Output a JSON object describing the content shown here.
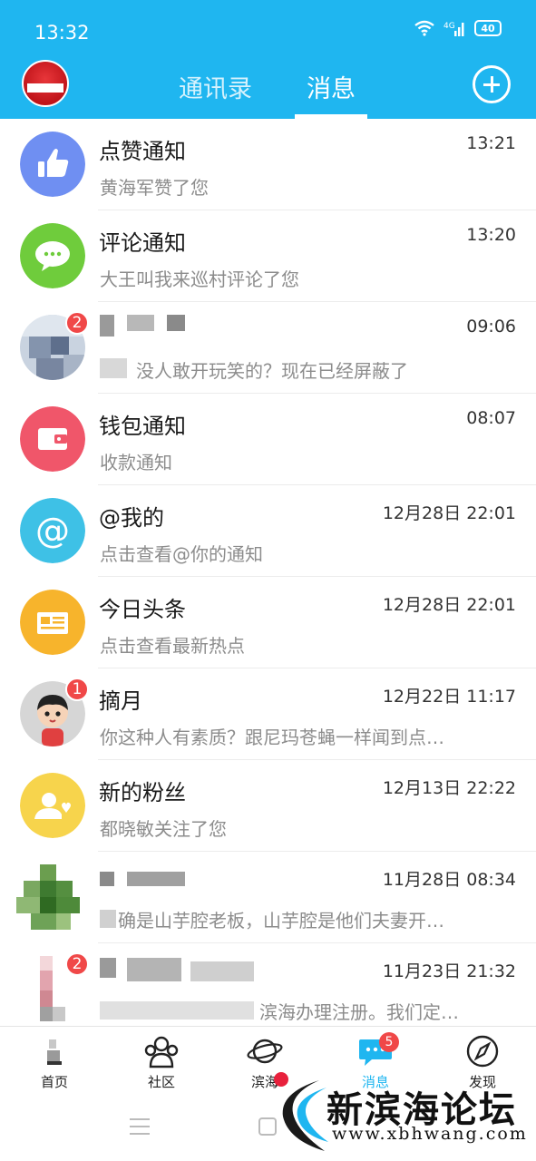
{
  "status": {
    "time": "13:32",
    "battery": "40"
  },
  "header": {
    "tabs": [
      {
        "label": "通讯录"
      },
      {
        "label": "消息"
      }
    ],
    "active_tab": "消息"
  },
  "messages": [
    {
      "title": "点赞通知",
      "time": "13:21",
      "preview": "黄海军赞了您",
      "icon": "thumbs-up-icon",
      "color": "#6f8ff2"
    },
    {
      "title": "评论通知",
      "time": "13:20",
      "preview": "大王叫我来巡村评论了您",
      "icon": "chat-bubble-icon",
      "color": "#6fcc3c"
    },
    {
      "title": "",
      "time": "09:06",
      "preview": "没人敢开玩笑的？现在已经屏蔽了",
      "badge": "2",
      "icon": "user-avatar",
      "color": "#9aaac0"
    },
    {
      "title": "钱包通知",
      "time": "08:07",
      "preview": "收款通知",
      "icon": "wallet-icon",
      "color": "#f0566a"
    },
    {
      "title": "@我的",
      "time": "12月28日 22:01",
      "preview": "点击查看@你的通知",
      "icon": "at-sign-icon",
      "color": "#3ec1e6"
    },
    {
      "title": "今日头条",
      "time": "12月28日 22:01",
      "preview": "点击查看最新热点",
      "icon": "newspaper-icon",
      "color": "#f7b42c"
    },
    {
      "title": "摘月",
      "time": "12月22日 11:17",
      "preview": "你这种人有素质？跟尼玛苍蝇一样闻到点…",
      "badge": "1",
      "icon": "user-avatar",
      "color": "#d6d6d6"
    },
    {
      "title": "新的粉丝",
      "time": "12月13日 22:22",
      "preview": "都晓敏关注了您",
      "icon": "new-follower-icon",
      "color": "#f7d44c"
    },
    {
      "title": "",
      "time": "11月28日 08:34",
      "preview": "确是山芋腔老板，山芋腔是他们夫妻开…",
      "icon": "user-avatar",
      "color": "#4c8a3c"
    },
    {
      "title": "",
      "time": "11月23日 21:32",
      "preview": "滨海办理注册。我们定…",
      "badge": "2",
      "icon": "user-avatar",
      "color": "#d8a0a8"
    }
  ],
  "bottom_nav": [
    {
      "label": "首页",
      "icon": "home-icon"
    },
    {
      "label": "社区",
      "icon": "community-icon"
    },
    {
      "label": "滨海",
      "icon": "planet-icon"
    },
    {
      "label": "消息",
      "icon": "message-icon",
      "badge": "5"
    },
    {
      "label": "发现",
      "icon": "compass-icon"
    }
  ],
  "watermark": {
    "name": "新滨海论坛",
    "url": "www.xbhwang.com"
  },
  "colors": {
    "accent": "#1fb6f0",
    "badge": "#f04848"
  }
}
